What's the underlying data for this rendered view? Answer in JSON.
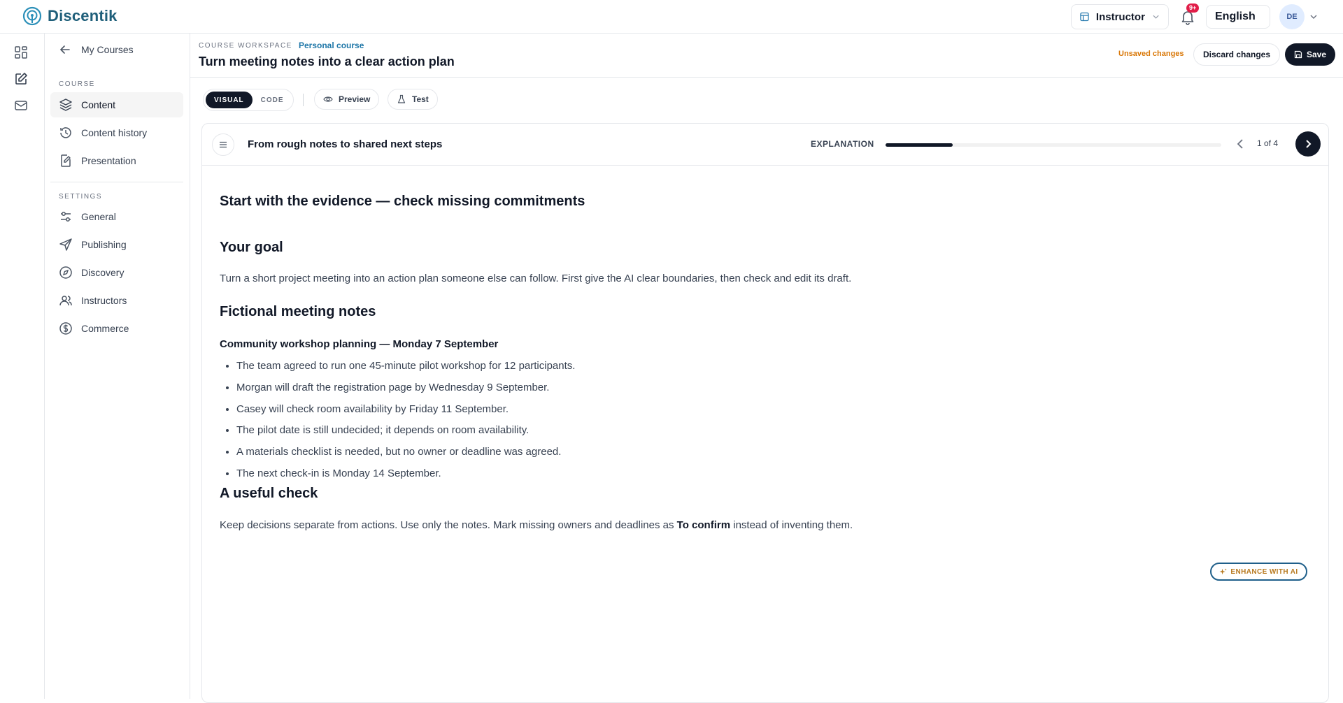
{
  "app": {
    "name": "Discentik"
  },
  "topbar": {
    "role": "Instructor",
    "notifications_badge": "9+",
    "language": "English",
    "avatar_initials": "DE"
  },
  "sidebar": {
    "back_label": "My Courses",
    "course_section": "COURSE",
    "course_items": [
      {
        "label": "Content",
        "icon": "layers-icon",
        "active": true
      },
      {
        "label": "Content history",
        "icon": "history-icon"
      },
      {
        "label": "Presentation",
        "icon": "edit-document-icon"
      }
    ],
    "settings_section": "SETTINGS",
    "settings_items": [
      {
        "label": "General",
        "icon": "sliders-icon"
      },
      {
        "label": "Publishing",
        "icon": "send-icon"
      },
      {
        "label": "Discovery",
        "icon": "compass-icon"
      },
      {
        "label": "Instructors",
        "icon": "users-icon"
      },
      {
        "label": "Commerce",
        "icon": "dollar-icon"
      }
    ]
  },
  "workspace": {
    "label": "COURSE WORKSPACE",
    "course_tag": "Personal course",
    "title": "Turn meeting notes into a clear action plan",
    "unsaved": "Unsaved changes",
    "discard_label": "Discard changes",
    "save_label": "Save"
  },
  "editor": {
    "mode_visual": "VISUAL",
    "mode_code": "CODE",
    "preview_label": "Preview",
    "test_label": "Test"
  },
  "lesson": {
    "step_title": "From rough notes to shared next steps",
    "step_kind": "EXPLANATION",
    "progress": 0.2,
    "pager": "1 of 4",
    "heading": "Start with the evidence — check missing commitments",
    "goal_heading": "Your goal",
    "goal_text": "Turn a short project meeting into an action plan someone else can follow. First give the AI clear boundaries, then check and edit its draft.",
    "notes_heading": "Fictional meeting notes",
    "notes_subheading": "Community workshop planning — Monday 7 September",
    "notes": [
      "The team agreed to run one 45-minute pilot workshop for 12 participants.",
      "Morgan will draft the registration page by Wednesday 9 September.",
      "Casey will check room availability by Friday 11 September.",
      "The pilot date is still undecided; it depends on room availability.",
      "A materials checklist is needed, but no owner or deadline was agreed.",
      "The next check-in is Monday 14 September."
    ],
    "check_heading": "A useful check",
    "check_text_before": "Keep decisions separate from actions. Use only the notes. Mark missing owners and deadlines as ",
    "check_text_bold": "To confirm",
    "check_text_after": " instead of inventing them.",
    "enhance_label": "ENHANCE WITH AI"
  },
  "colors": {
    "brand": "#1f5f7a",
    "primary_dark": "#111827",
    "warning": "#d97706",
    "badge": "#e11d48"
  }
}
